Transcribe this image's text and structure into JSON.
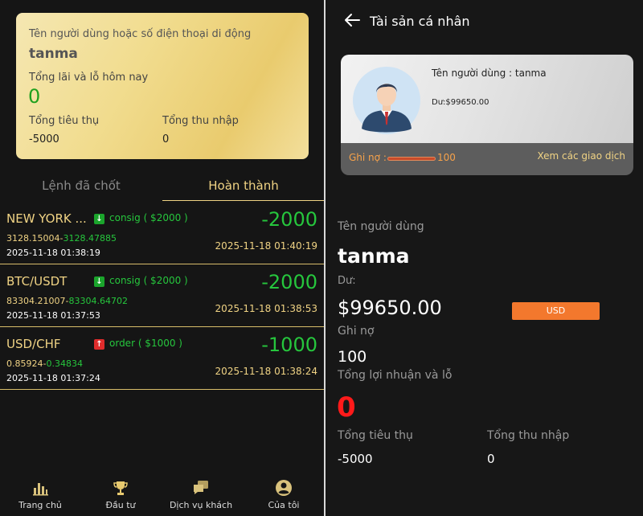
{
  "summary": {
    "user_label": "Tên người dùng hoặc số điện thoại di động",
    "user_value": "tanma",
    "pnl_label": "Tổng lãi và lỗ hôm nay",
    "pnl_value": "0",
    "consumption_label": "Tổng tiêu thụ",
    "consumption_value": "-5000",
    "income_label": "Tổng thu nhập",
    "income_value": "0"
  },
  "tabs": [
    {
      "label": "Lệnh đã chốt",
      "active": false
    },
    {
      "label": "Hoàn thành",
      "active": true
    }
  ],
  "orders": [
    {
      "symbol": "NEW YORK ...",
      "direction": "down",
      "type_text": "consig ( $2000 )",
      "open_price": "3128.15004",
      "close_price": "3128.47885",
      "pnl": "-2000",
      "open_time": "2025-11-18 01:38:19",
      "close_time": "2025-11-18 01:40:19"
    },
    {
      "symbol": "BTC/USDT",
      "direction": "down",
      "type_text": "consig ( $2000 )",
      "open_price": "83304.21007",
      "close_price": "83304.64702",
      "pnl": "-2000",
      "open_time": "2025-11-18 01:37:53",
      "close_time": "2025-11-18 01:38:53"
    },
    {
      "symbol": "USD/CHF",
      "direction": "up",
      "type_text": "order ( $1000 )",
      "open_price": "0.85924",
      "close_price": "0.34834",
      "pnl": "-1000",
      "open_time": "2025-11-18 01:37:24",
      "close_time": "2025-11-18 01:38:24"
    }
  ],
  "bottom_nav": [
    {
      "label": "Trang chủ",
      "icon": "bar-chart-icon"
    },
    {
      "label": "Đầu tư",
      "icon": "trophy-icon"
    },
    {
      "label": "Dịch vụ khách",
      "icon": "chat-icon"
    },
    {
      "label": "Của tôi",
      "icon": "user-icon"
    }
  ],
  "detail": {
    "header_title": "Tài sản cá nhân",
    "card": {
      "username_text": "Tên người dùng : tanma",
      "balance_text": "Dư:$99650.00",
      "debt_label": "Ghi nợ :",
      "debt_value": "100",
      "history_link": "Xem các giao dịch"
    },
    "username_label": "Tên người dùng",
    "username_value": "tanma",
    "balance_label": "Dư:",
    "balance_value": "$99650.00",
    "currency_button": "USD",
    "debt_label": "Ghi nợ",
    "debt_value": "100",
    "pnl_label": "Tổng lợi nhuận và lỗ",
    "pnl_value": "0",
    "consumption_label": "Tổng tiêu thụ",
    "consumption_value": "-5000",
    "income_label": "Tổng thu nhập",
    "income_value": "0"
  },
  "colors": {
    "accent_gold": "#f0d384",
    "profit_green": "#26c63d",
    "loss_red": "#ff1a1a",
    "currency_orange": "#f3782d"
  }
}
